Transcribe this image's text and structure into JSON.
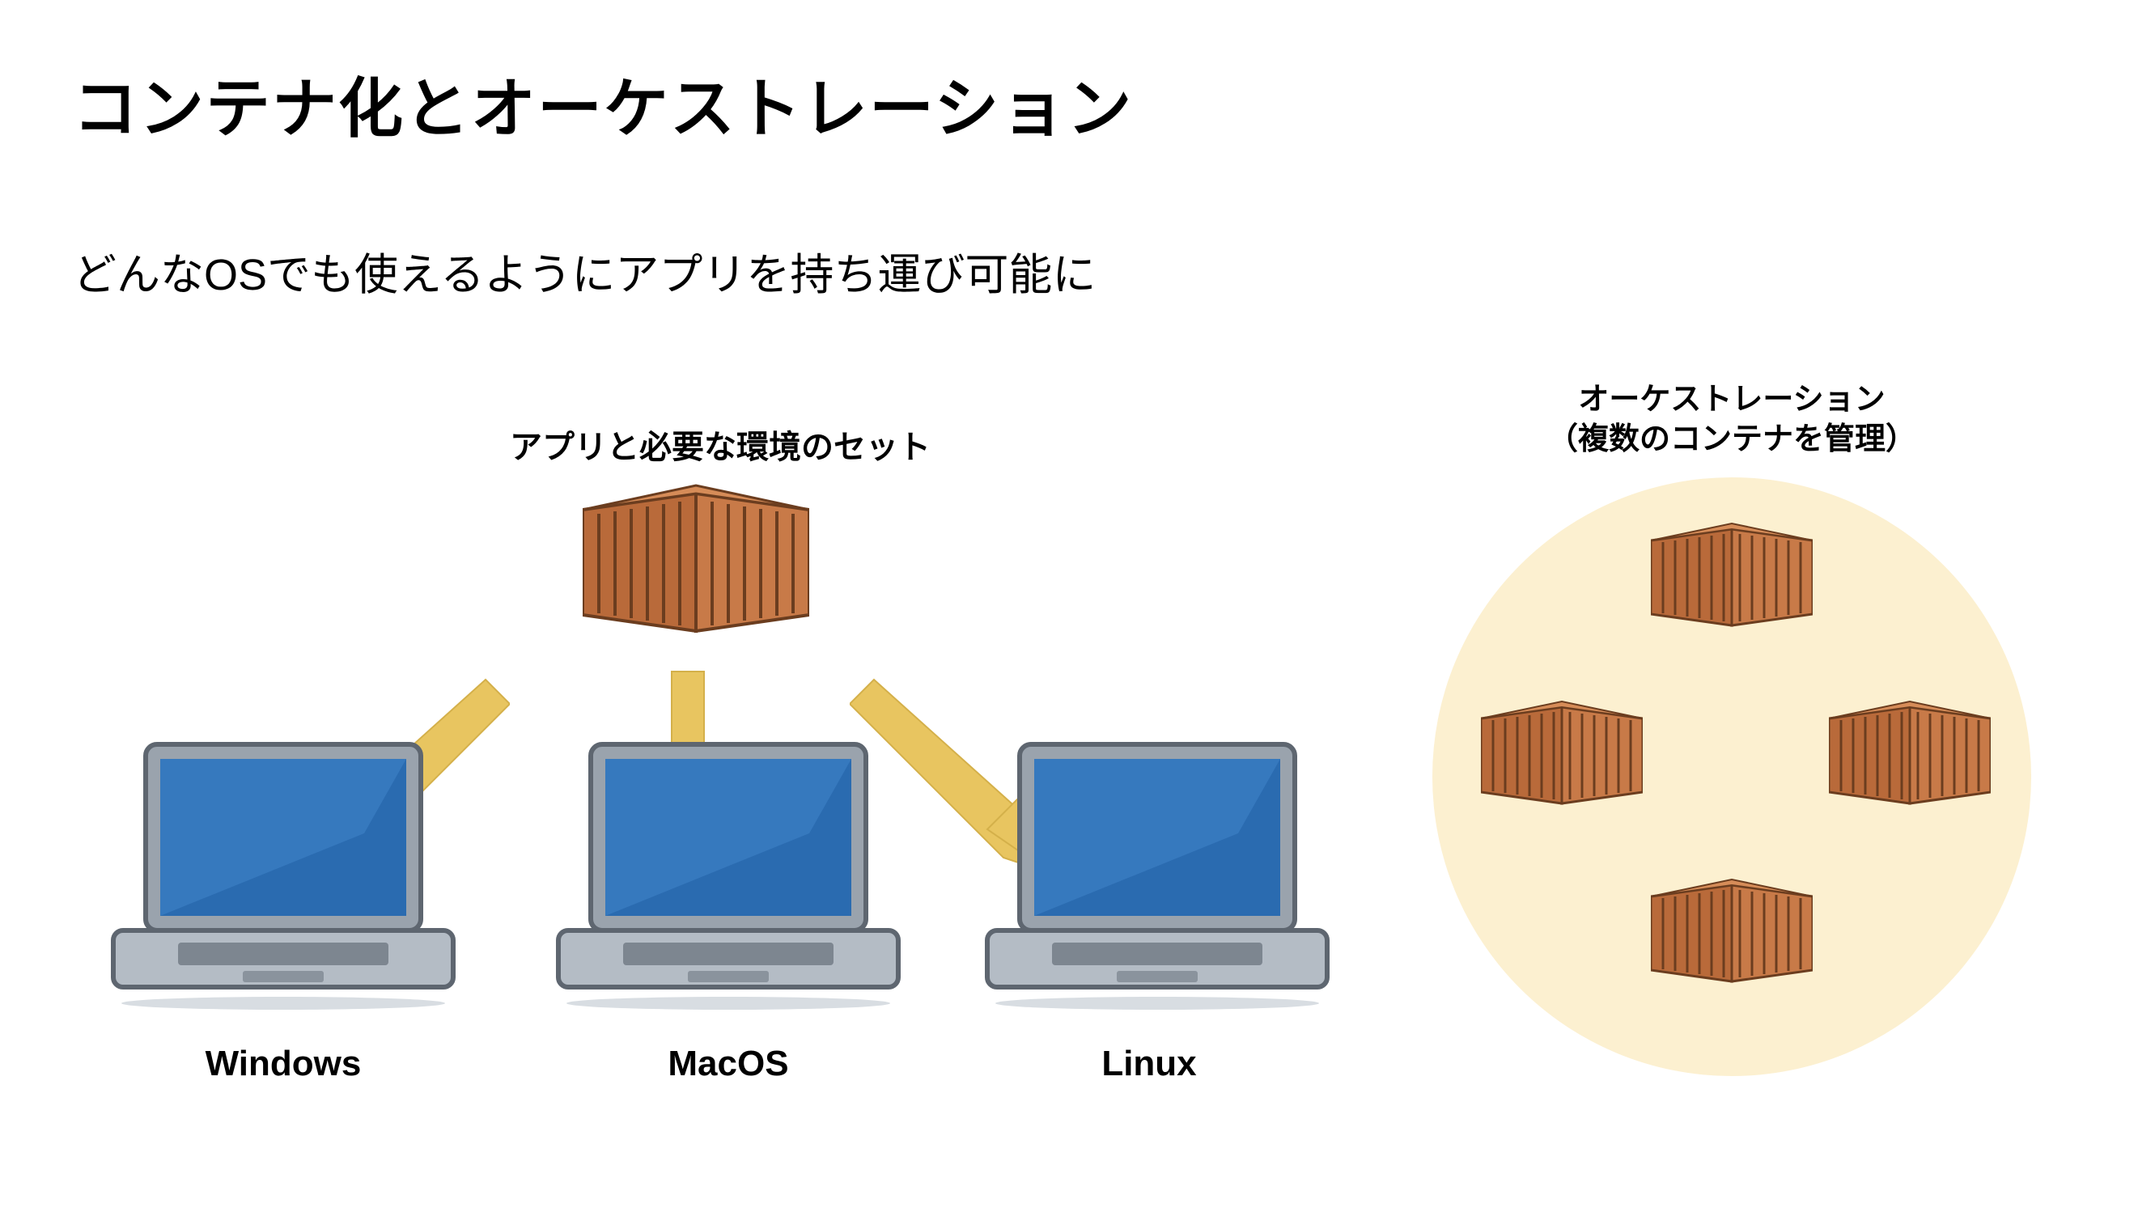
{
  "title": "コンテナ化とオーケストレーション",
  "subtitle": "どんなOSでも使えるようにアプリを持ち運び可能に",
  "containerLabel": "アプリと必要な環境のセット",
  "orchestrationLabel": "オーケストレーション\n（複数のコンテナを管理）",
  "laptops": [
    {
      "label": "Windows"
    },
    {
      "label": "MacOS"
    },
    {
      "label": "Linux"
    }
  ],
  "icons": {
    "container": "container-icon",
    "laptop": "laptop-icon",
    "arrow": "arrow-icon"
  }
}
